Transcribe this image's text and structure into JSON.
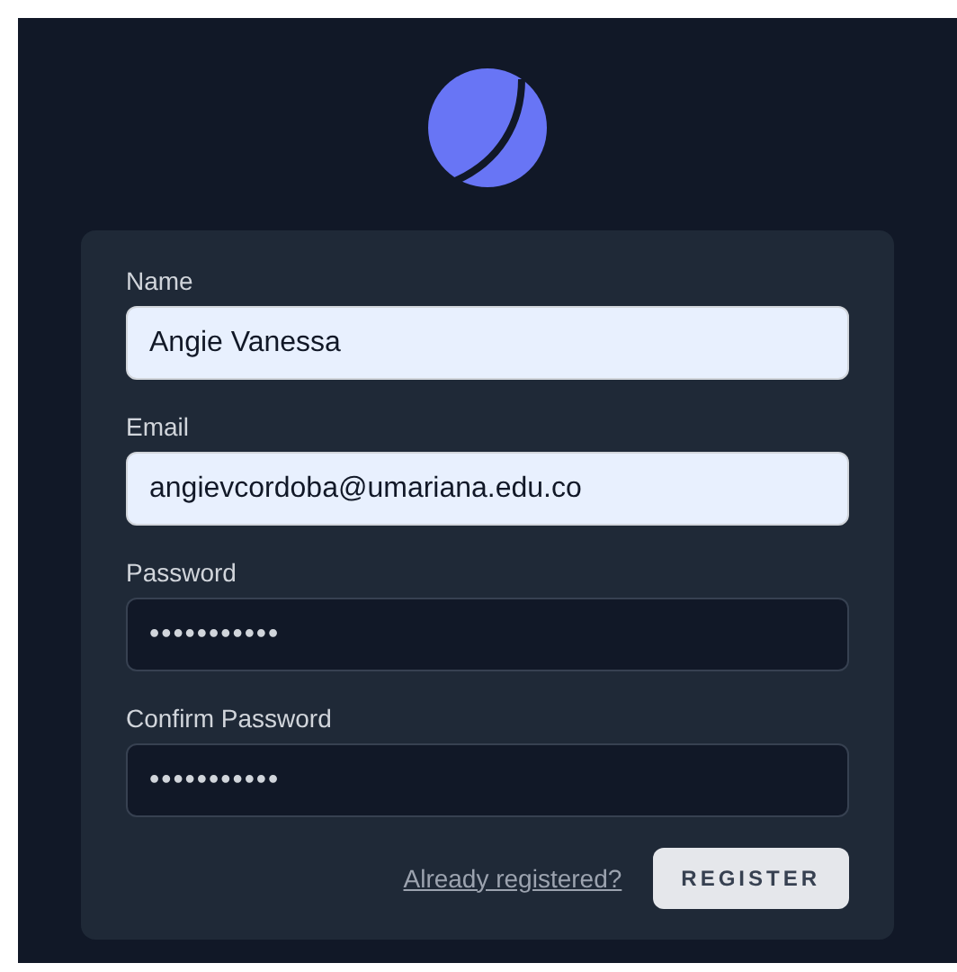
{
  "fields": [
    {
      "label": "Name",
      "value": "Angie Vanessa",
      "autofilled": true
    },
    {
      "label": "Email",
      "value": "angievcordoba@umariana.edu.co",
      "autofilled": true
    },
    {
      "label": "Password",
      "value": "•••••••••••",
      "autofilled": false
    },
    {
      "label": "Confirm Password",
      "value": "•••••••••••",
      "autofilled": false
    }
  ],
  "link": "Already registered?",
  "button": "REGISTER"
}
